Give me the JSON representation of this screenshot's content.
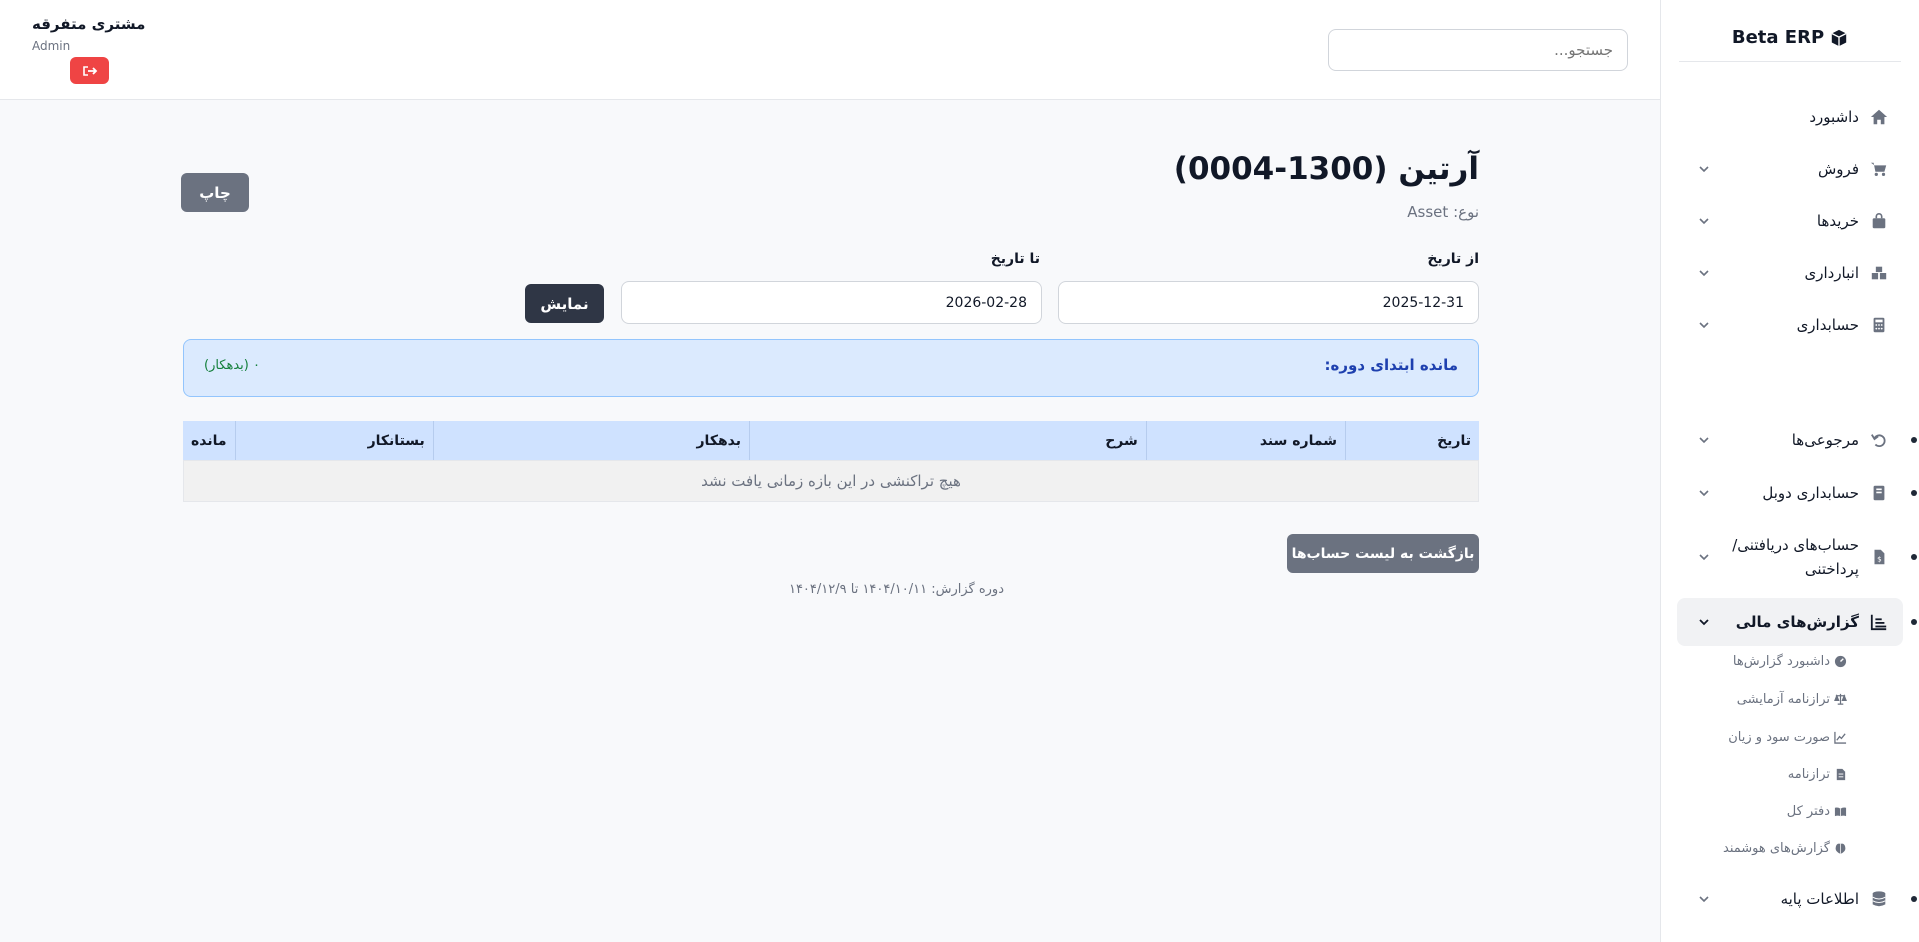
{
  "brand": {
    "name": "Beta ERP",
    "icon": "cube-icon"
  },
  "sidebar": {
    "items": [
      {
        "label": "داشبورد",
        "icon": "home-icon"
      },
      {
        "label": "فروش",
        "icon": "cart-icon"
      },
      {
        "label": "خریدها",
        "icon": "bag-icon"
      },
      {
        "label": "انبارداری",
        "icon": "boxes-icon"
      },
      {
        "label": "حسابداری",
        "icon": "calculator-icon"
      },
      {
        "label": "مرجوعی‌ها",
        "icon": "undo-icon"
      },
      {
        "label": "حسابداری دوبل",
        "icon": "book-icon"
      },
      {
        "label": "حساب‌های دریافتنی/ پرداختنی",
        "icon": "invoice-icon"
      },
      {
        "label": "گزارش‌های مالی",
        "icon": "chart-icon"
      },
      {
        "label": "اطلاعات پایه",
        "icon": "database-icon"
      }
    ],
    "sub_items": [
      {
        "label": "داشبورد گزارش‌ها",
        "icon": "gauge-icon"
      },
      {
        "label": "ترازنامه آزمایشی",
        "icon": "scale-icon"
      },
      {
        "label": "صورت سود و زیان",
        "icon": "line-chart-icon"
      },
      {
        "label": "ترازنامه",
        "icon": "document-icon"
      },
      {
        "label": "دفتر کل",
        "icon": "open-book-icon"
      },
      {
        "label": "گزارش‌های هوشمند",
        "icon": "brain-icon"
      }
    ]
  },
  "header": {
    "search_placeholder": "جستجو...",
    "user_name": "مشتری متفرقه",
    "user_role": "Admin"
  },
  "main": {
    "title": "آرتین (1300-0004)",
    "type_text": "نوع: Asset",
    "print_label": "چاپ",
    "from_label": "از تاریخ",
    "to_label": "تا تاریخ",
    "from_value": "2025-12-31",
    "to_value": "2026-02-28",
    "show_label": "نمایش",
    "opening_label": "مانده ابتدای دوره:",
    "opening_value": "۰ (بدهکار)",
    "table": {
      "headers": [
        "تاریخ",
        "شماره سند",
        "شرح",
        "بدهکار",
        "بستانکار",
        "مانده"
      ],
      "empty_text": "هیچ تراکنشی در این بازه زمانی یافت نشد"
    },
    "back_label": "بازگشت به لیست حساب‌ها",
    "period_text": "دوره گزارش: ۱۴۰۴/۱۰/۱۱ تا ۱۴۰۴/۱۲/۹"
  },
  "colors": {
    "danger": "#ef4444",
    "primary_dark": "#2f3645",
    "secondary": "#6b7280",
    "info_bg": "#dbeafe",
    "info_text": "#1e40af",
    "success_text": "#15803d",
    "table_header": "#cfe2ff"
  }
}
